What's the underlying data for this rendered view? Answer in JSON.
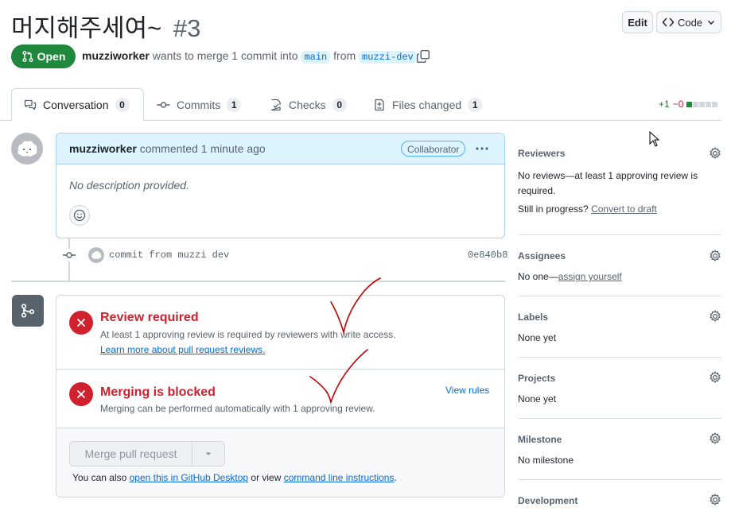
{
  "header": {
    "title": "머지해주세여~",
    "number": "#3",
    "edit_label": "Edit",
    "code_label": "Code"
  },
  "status": {
    "state_label": "Open",
    "author": "muzziworker",
    "merge_text": "wants to merge 1 commit into",
    "base_branch": "main",
    "from_text": "from",
    "head_branch": "muzzi-dev"
  },
  "tabs": [
    {
      "label": "Conversation",
      "count": "0"
    },
    {
      "label": "Commits",
      "count": "1"
    },
    {
      "label": "Checks",
      "count": "0"
    },
    {
      "label": "Files changed",
      "count": "1"
    }
  ],
  "diffstat": {
    "additions": "+1",
    "deletions": "−0"
  },
  "comment": {
    "author": "muzziworker",
    "action": "commented 1 minute ago",
    "badge": "Collaborator",
    "body": "No description provided."
  },
  "commit": {
    "message": "commit from muzzi dev",
    "sha": "0e840b8"
  },
  "merge_box": {
    "review_title": "Review required",
    "review_desc": "At least 1 approving review is required by reviewers with write access.",
    "review_link": "Learn more about pull request reviews.",
    "blocked_title": "Merging is blocked",
    "blocked_desc": "Merging can be performed automatically with 1 approving review.",
    "view_rules": "View rules",
    "merge_button": "Merge pull request",
    "footer_prefix": "You can also",
    "footer_link1": "open this in GitHub Desktop",
    "footer_mid": "or view",
    "footer_link2": "command line instructions",
    "footer_suffix": "."
  },
  "sidebar": {
    "reviewers": {
      "heading": "Reviewers",
      "text": "No reviews—at least 1 approving review is required.",
      "progress_text": "Still in progress?",
      "progress_link": "Convert to draft"
    },
    "assignees": {
      "heading": "Assignees",
      "prefix": "No one—",
      "link": "assign yourself"
    },
    "labels": {
      "heading": "Labels",
      "text": "None yet"
    },
    "projects": {
      "heading": "Projects",
      "text": "None yet"
    },
    "milestone": {
      "heading": "Milestone",
      "text": "No milestone"
    },
    "development": {
      "heading": "Development"
    }
  },
  "colors": {
    "open_green": "#1f883d",
    "danger_red": "#cf222e",
    "link_blue": "#0969da",
    "comment_header_bg": "#ddf4ff",
    "annotation_red": "#c00000"
  }
}
